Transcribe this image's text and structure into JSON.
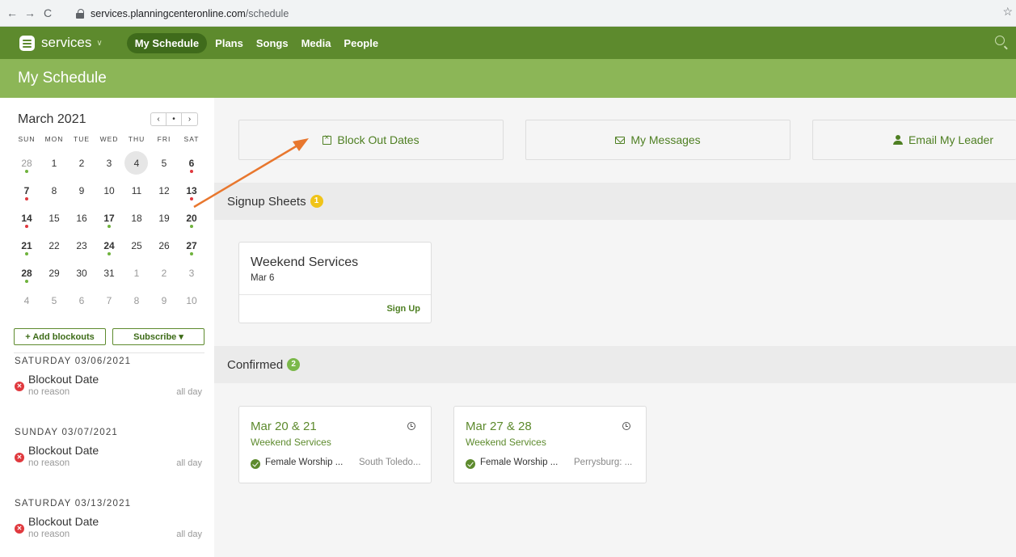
{
  "browser": {
    "back": "←",
    "forward": "→",
    "reload": "C",
    "url_host": "services.planningcenteronline.com",
    "url_path": "/schedule",
    "star": "☆"
  },
  "topnav": {
    "brand": "services",
    "caret": "∨",
    "items": [
      {
        "label": "My Schedule",
        "active": true
      },
      {
        "label": "Plans"
      },
      {
        "label": "Songs"
      },
      {
        "label": "Media"
      },
      {
        "label": "People"
      }
    ]
  },
  "page": {
    "title": "My Schedule"
  },
  "calendar": {
    "month": "March 2021",
    "nav": [
      "‹",
      "•",
      "›"
    ],
    "weekdays": [
      "SUN",
      "MON",
      "TUE",
      "WED",
      "THU",
      "FRI",
      "SAT"
    ],
    "weeks": [
      [
        [
          "28",
          "muted",
          "green"
        ],
        [
          "1",
          "",
          ""
        ],
        [
          "2",
          "",
          ""
        ],
        [
          "3",
          "",
          ""
        ],
        [
          "4",
          "today",
          ""
        ],
        [
          "5",
          "",
          ""
        ],
        [
          "6",
          "bold",
          "red"
        ]
      ],
      [
        [
          "7",
          "bold",
          "red"
        ],
        [
          "8",
          "",
          ""
        ],
        [
          "9",
          "",
          ""
        ],
        [
          "10",
          "",
          ""
        ],
        [
          "11",
          "",
          ""
        ],
        [
          "12",
          "",
          ""
        ],
        [
          "13",
          "bold",
          "red"
        ]
      ],
      [
        [
          "14",
          "bold",
          "red"
        ],
        [
          "15",
          "",
          ""
        ],
        [
          "16",
          "",
          ""
        ],
        [
          "17",
          "bold",
          "green"
        ],
        [
          "18",
          "",
          ""
        ],
        [
          "19",
          "",
          ""
        ],
        [
          "20",
          "bold",
          "green"
        ]
      ],
      [
        [
          "21",
          "bold",
          "green"
        ],
        [
          "22",
          "",
          ""
        ],
        [
          "23",
          "",
          ""
        ],
        [
          "24",
          "bold",
          "green"
        ],
        [
          "25",
          "",
          ""
        ],
        [
          "26",
          "",
          ""
        ],
        [
          "27",
          "bold",
          "green"
        ]
      ],
      [
        [
          "28",
          "bold",
          "green"
        ],
        [
          "29",
          "",
          ""
        ],
        [
          "30",
          "",
          ""
        ],
        [
          "31",
          "",
          ""
        ],
        [
          "1",
          "muted",
          ""
        ],
        [
          "2",
          "muted",
          ""
        ],
        [
          "3",
          "muted",
          ""
        ]
      ],
      [
        [
          "4",
          "muted",
          ""
        ],
        [
          "5",
          "muted",
          ""
        ],
        [
          "6",
          "muted",
          ""
        ],
        [
          "7",
          "muted",
          ""
        ],
        [
          "8",
          "muted",
          ""
        ],
        [
          "9",
          "muted",
          ""
        ],
        [
          "10",
          "muted",
          ""
        ]
      ]
    ],
    "add_blockouts": "+ Add blockouts",
    "subscribe": "Subscribe ▾"
  },
  "blockouts": [
    {
      "date": "SATURDAY 03/06/2021",
      "title": "Blockout Date",
      "reason": "no reason",
      "duration": "all day"
    },
    {
      "date": "SUNDAY 03/07/2021",
      "title": "Blockout Date",
      "reason": "no reason",
      "duration": "all day"
    },
    {
      "date": "SATURDAY 03/13/2021",
      "title": "Blockout Date",
      "reason": "no reason",
      "duration": "all day"
    }
  ],
  "actions": {
    "block_out": "Block Out Dates",
    "messages": "My Messages",
    "email_leader": "Email My Leader"
  },
  "signup": {
    "section_title": "Signup Sheets",
    "count": "1",
    "card": {
      "title": "Weekend Services",
      "date": "Mar 6",
      "link": "Sign Up"
    }
  },
  "confirmed": {
    "section_title": "Confirmed",
    "count": "2",
    "cards": [
      {
        "dates": "Mar 20 & 21",
        "service": "Weekend Services",
        "role": "Female Worship ...",
        "location": "South Toledo..."
      },
      {
        "dates": "Mar 27 & 28",
        "service": "Weekend Services",
        "role": "Female Worship ...",
        "location": "Perrysburg: ..."
      }
    ]
  },
  "colors": {
    "nav_green": "#5d8a2d",
    "header_green": "#8cb657",
    "annotation_arrow": "#e8772e",
    "blockout_red": "#e0393e",
    "badge_yellow": "#f0c419"
  }
}
